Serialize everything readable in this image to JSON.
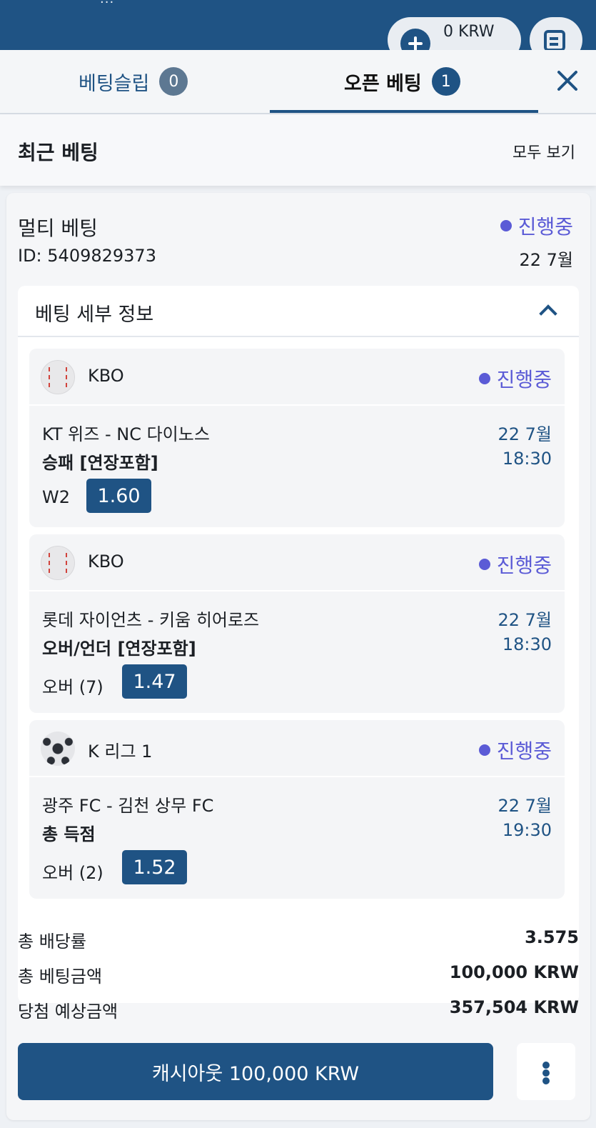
{
  "header": {
    "partial_text": "...",
    "balance": "0 KRW"
  },
  "tabs": {
    "betslip_label": "베팅슬립",
    "betslip_count": "0",
    "open_label": "오픈 베팅",
    "open_count": "1"
  },
  "recent": {
    "title": "최근 베팅",
    "view_all": "모두 보기"
  },
  "bet": {
    "type": "멀티 베팅",
    "id": "ID: 5409829373",
    "status": "진행중",
    "date": "22 7월",
    "details_title": "베팅 세부 정보",
    "selections": [
      {
        "sport_icon": "baseball-icon",
        "league": "KBO",
        "status": "진행중",
        "match": "KT 위즈 - NC 다이노스",
        "market": "승패 [연장포함]",
        "pick": "W2",
        "odds": "1.60",
        "date": "22 7월",
        "time": "18:30"
      },
      {
        "sport_icon": "baseball-icon",
        "league": "KBO",
        "status": "진행중",
        "match": "롯데 자이언츠 - 키움 히어로즈",
        "market": "오버/언더 [연장포함]",
        "pick": "오버 (7)",
        "odds": "1.47",
        "date": "22 7월",
        "time": "18:30"
      },
      {
        "sport_icon": "soccer-ball-icon",
        "league": "K 리그 1",
        "status": "진행중",
        "match": "광주 FC - 김천 상무 FC",
        "market": "총 득점",
        "pick": "오버 (2)",
        "odds": "1.52",
        "date": "22 7월",
        "time": "19:30"
      }
    ],
    "summary": {
      "total_odds_label": "총 배당률",
      "total_odds_value": "3.575",
      "stake_label": "총 베팅금액",
      "stake_value": "100,000 KRW",
      "potential_label": "당첨 예상금액",
      "potential_value": "357,504 KRW"
    },
    "cashout_label": "캐시아웃 100,000 KRW"
  },
  "colors": {
    "brand": "#1f5384",
    "status": "#5b5bd6",
    "badge_inactive": "#5d7892"
  }
}
